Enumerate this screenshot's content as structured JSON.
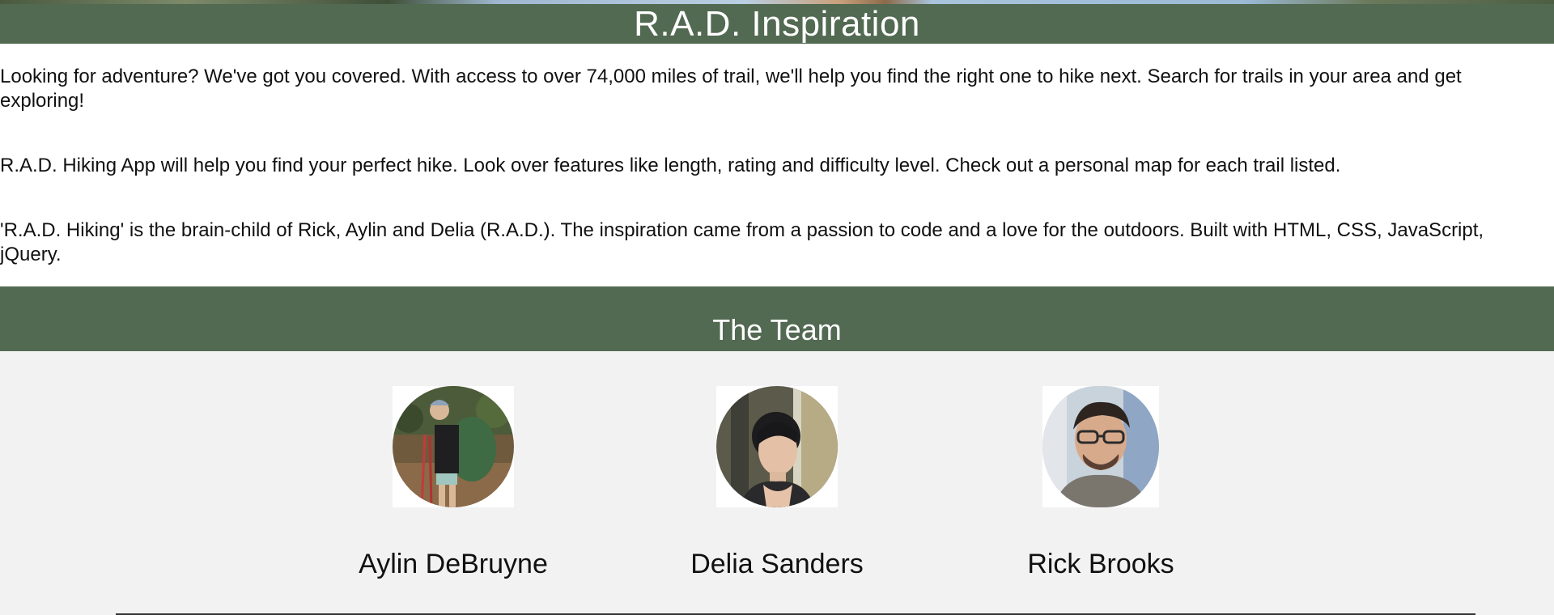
{
  "header": {
    "title": "R.A.D. Inspiration"
  },
  "intro": {
    "paragraphs": [
      "Looking for adventure? We've got you covered. With access to over 74,000 miles of trail, we'll help you find the right one to hike next. Search for trails in your area and get exploring!",
      "R.A.D. Hiking App will help you find your perfect hike. Look over features like length, rating and difficulty level. Check out a personal map for each trail listed.",
      "'R.A.D. Hiking' is the brain-child of Rick, Aylin and Delia (R.A.D.). The inspiration came from a passion to code and a love for the outdoors. Built with HTML, CSS, JavaScript, jQuery."
    ]
  },
  "team": {
    "heading": "The Team",
    "members": [
      {
        "name": "Aylin DeBruyne"
      },
      {
        "name": "Delia Sanders"
      },
      {
        "name": "Rick Brooks"
      }
    ]
  },
  "colors": {
    "band_green": "#526952",
    "page_bg": "#f2f2f2",
    "intro_bg": "#ffffff"
  }
}
